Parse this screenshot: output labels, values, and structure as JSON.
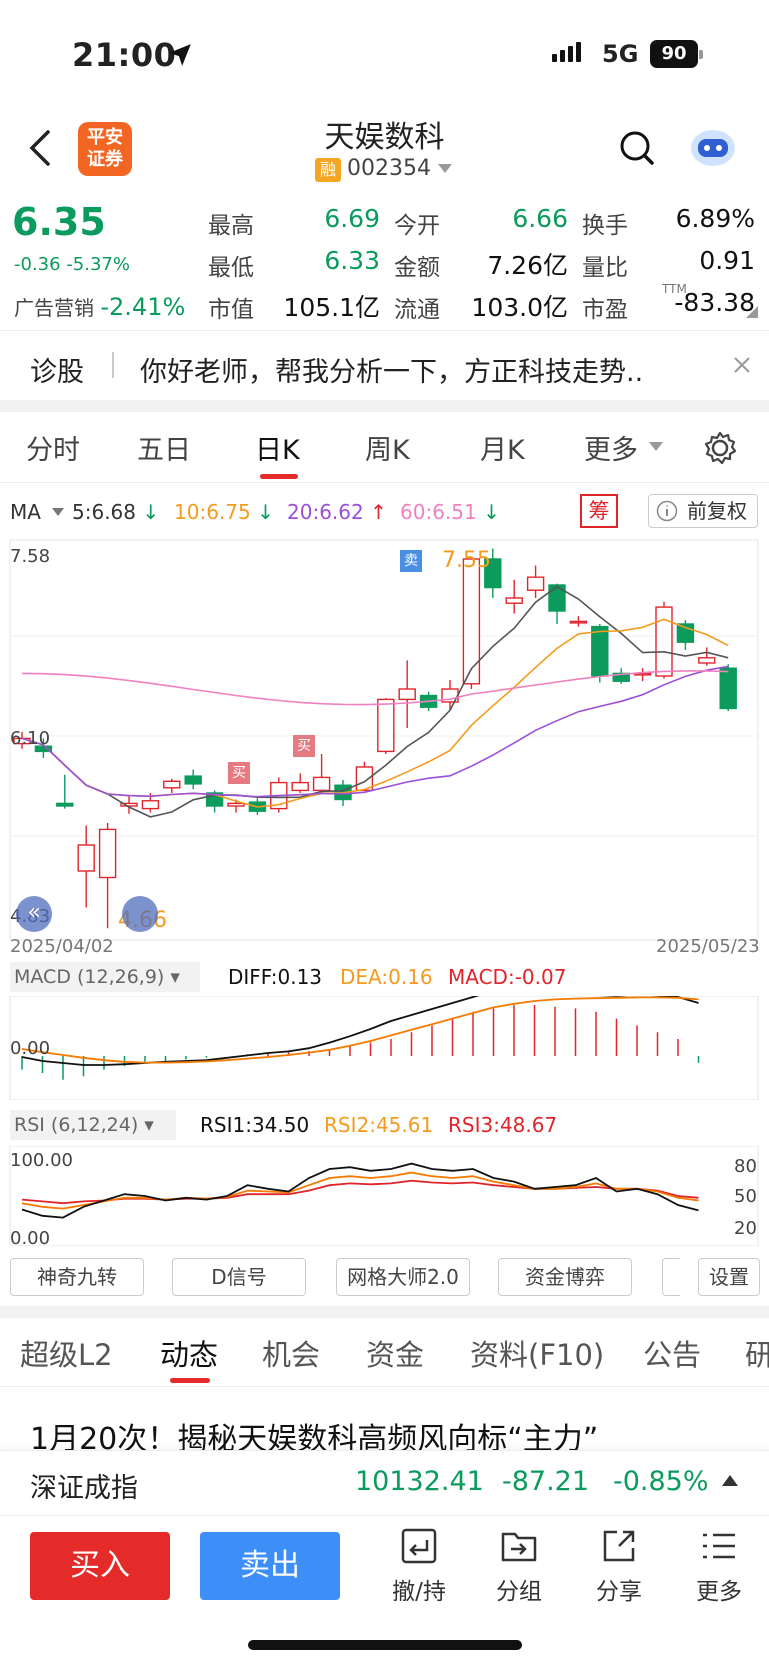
{
  "status": {
    "time": "21:00",
    "network": "5G",
    "battery": "90"
  },
  "header": {
    "broker_logo": "平安\n证券",
    "title": "天娱数科",
    "margin_badge": "融",
    "code": "002354"
  },
  "quote": {
    "price": "6.35",
    "change": "-0.36 -5.37%",
    "ad_label": "广告营销",
    "ad_value": "-2.41%",
    "fields": [
      {
        "label": "最高",
        "value": "6.69",
        "color": "green"
      },
      {
        "label": "今开",
        "value": "6.66",
        "color": "green"
      },
      {
        "label": "换手",
        "value": "6.89%",
        "color": "black"
      },
      {
        "label": "最低",
        "value": "6.33",
        "color": "green"
      },
      {
        "label": "金额",
        "value": "7.26亿",
        "color": "black"
      },
      {
        "label": "量比",
        "value": "0.91",
        "color": "black"
      },
      {
        "label": "市值",
        "value": "105.1亿",
        "color": "black"
      },
      {
        "label": "流通",
        "value": "103.0亿",
        "color": "black"
      },
      {
        "label": "市盈",
        "value": "-83.38",
        "color": "black"
      }
    ],
    "pe_sup": "TTM"
  },
  "diagnose": {
    "label": "诊股",
    "text": "你好老师，帮我分析一下，方正科技走势.."
  },
  "tabs": {
    "items": [
      "分时",
      "五日",
      "日K",
      "周K",
      "月K",
      "更多"
    ],
    "active": "日K"
  },
  "ma": {
    "label": "MA",
    "ma5": "5:6.68",
    "ma10": "10:6.75",
    "ma20": "20:6.62",
    "ma60": "60:6.51",
    "chou": "筹",
    "adjust": "前复权"
  },
  "kline": {
    "high_label": "7.58",
    "mid_label": "6.10",
    "low_label": "4.83",
    "max_mark": "7.55",
    "min_mark": "4.66",
    "start_date": "2025/04/02",
    "end_date": "2025/05/23",
    "sell_tag": "卖",
    "buy_tag": "买",
    "candles": [
      {
        "o": 6.08,
        "c": 6.12,
        "h": 6.17,
        "l": 6.04
      },
      {
        "o": 6.06,
        "c": 6.02,
        "h": 6.12,
        "l": 5.97
      },
      {
        "o": 5.62,
        "c": 5.6,
        "h": 5.84,
        "l": 5.58
      },
      {
        "o": 5.1,
        "c": 5.3,
        "h": 5.45,
        "l": 4.82
      },
      {
        "o": 5.05,
        "c": 5.42,
        "h": 5.47,
        "l": 4.66
      },
      {
        "o": 5.6,
        "c": 5.62,
        "h": 5.68,
        "l": 5.54
      },
      {
        "o": 5.58,
        "c": 5.64,
        "h": 5.7,
        "l": 5.55
      },
      {
        "o": 5.74,
        "c": 5.79,
        "h": 5.81,
        "l": 5.7
      },
      {
        "o": 5.83,
        "c": 5.77,
        "h": 5.88,
        "l": 5.73
      },
      {
        "o": 5.7,
        "c": 5.6,
        "h": 5.72,
        "l": 5.55
      },
      {
        "o": 5.6,
        "c": 5.62,
        "h": 5.65,
        "l": 5.55
      },
      {
        "o": 5.63,
        "c": 5.56,
        "h": 5.66,
        "l": 5.53
      },
      {
        "o": 5.58,
        "c": 5.78,
        "h": 5.82,
        "l": 5.55
      },
      {
        "o": 5.72,
        "c": 5.78,
        "h": 5.85,
        "l": 5.7
      },
      {
        "o": 5.72,
        "c": 5.82,
        "h": 6.0,
        "l": 5.7
      },
      {
        "o": 5.76,
        "c": 5.65,
        "h": 5.8,
        "l": 5.6
      },
      {
        "o": 5.72,
        "c": 5.9,
        "h": 5.94,
        "l": 5.72
      },
      {
        "o": 6.02,
        "c": 6.42,
        "h": 6.43,
        "l": 6.0
      },
      {
        "o": 6.42,
        "c": 6.5,
        "h": 6.72,
        "l": 6.2
      },
      {
        "o": 6.45,
        "c": 6.36,
        "h": 6.48,
        "l": 6.33
      },
      {
        "o": 6.4,
        "c": 6.5,
        "h": 6.57,
        "l": 6.34
      },
      {
        "o": 6.54,
        "c": 7.5,
        "h": 7.52,
        "l": 6.5
      },
      {
        "o": 7.5,
        "c": 7.28,
        "h": 7.58,
        "l": 7.2
      },
      {
        "o": 7.16,
        "c": 7.2,
        "h": 7.34,
        "l": 7.08
      },
      {
        "o": 7.26,
        "c": 7.36,
        "h": 7.45,
        "l": 7.2
      },
      {
        "o": 7.3,
        "c": 7.1,
        "h": 7.31,
        "l": 7.0
      },
      {
        "o": 7.02,
        "c": 7.02,
        "h": 7.06,
        "l": 6.98
      },
      {
        "o": 6.98,
        "c": 6.6,
        "h": 7.0,
        "l": 6.55
      },
      {
        "o": 6.62,
        "c": 6.56,
        "h": 6.66,
        "l": 6.54
      },
      {
        "o": 6.62,
        "c": 6.62,
        "h": 6.66,
        "l": 6.56
      },
      {
        "o": 6.6,
        "c": 7.13,
        "h": 7.17,
        "l": 6.58
      },
      {
        "o": 7.0,
        "c": 6.86,
        "h": 7.03,
        "l": 6.8
      },
      {
        "o": 6.7,
        "c": 6.74,
        "h": 6.82,
        "l": 6.68
      },
      {
        "o": 6.66,
        "c": 6.35,
        "h": 6.69,
        "l": 6.33
      }
    ]
  },
  "macd": {
    "label": "MACD (12,26,9)",
    "diff": "DIFF:0.13",
    "dea": "DEA:0.16",
    "macd": "MACD:-0.07",
    "zero": "0.00"
  },
  "rsi": {
    "label": "RSI (6,12,24)",
    "rsi1": "RSI1:34.50",
    "rsi2": "RSI2:45.61",
    "rsi3": "RSI3:48.67",
    "top": "100.00",
    "bottom": "0.00",
    "r80": "80",
    "r50": "50",
    "r20": "20"
  },
  "tools": [
    "神奇九转",
    "D信号",
    "网格大师2.0",
    "资金博弈",
    "设置"
  ],
  "sections": [
    "超级L2",
    "动态",
    "机会",
    "资金",
    "资料(F10)",
    "公告",
    "研"
  ],
  "news": {
    "headline": "1月20次！揭秘天娱数科高频风向标“主力”"
  },
  "index": {
    "name": "深证成指",
    "value": "10132.41",
    "change": "-87.21",
    "pct": "-0.85%"
  },
  "actions": {
    "buy": "买入",
    "sell": "卖出",
    "items": [
      "撤/持",
      "分组",
      "分享",
      "更多"
    ]
  }
}
